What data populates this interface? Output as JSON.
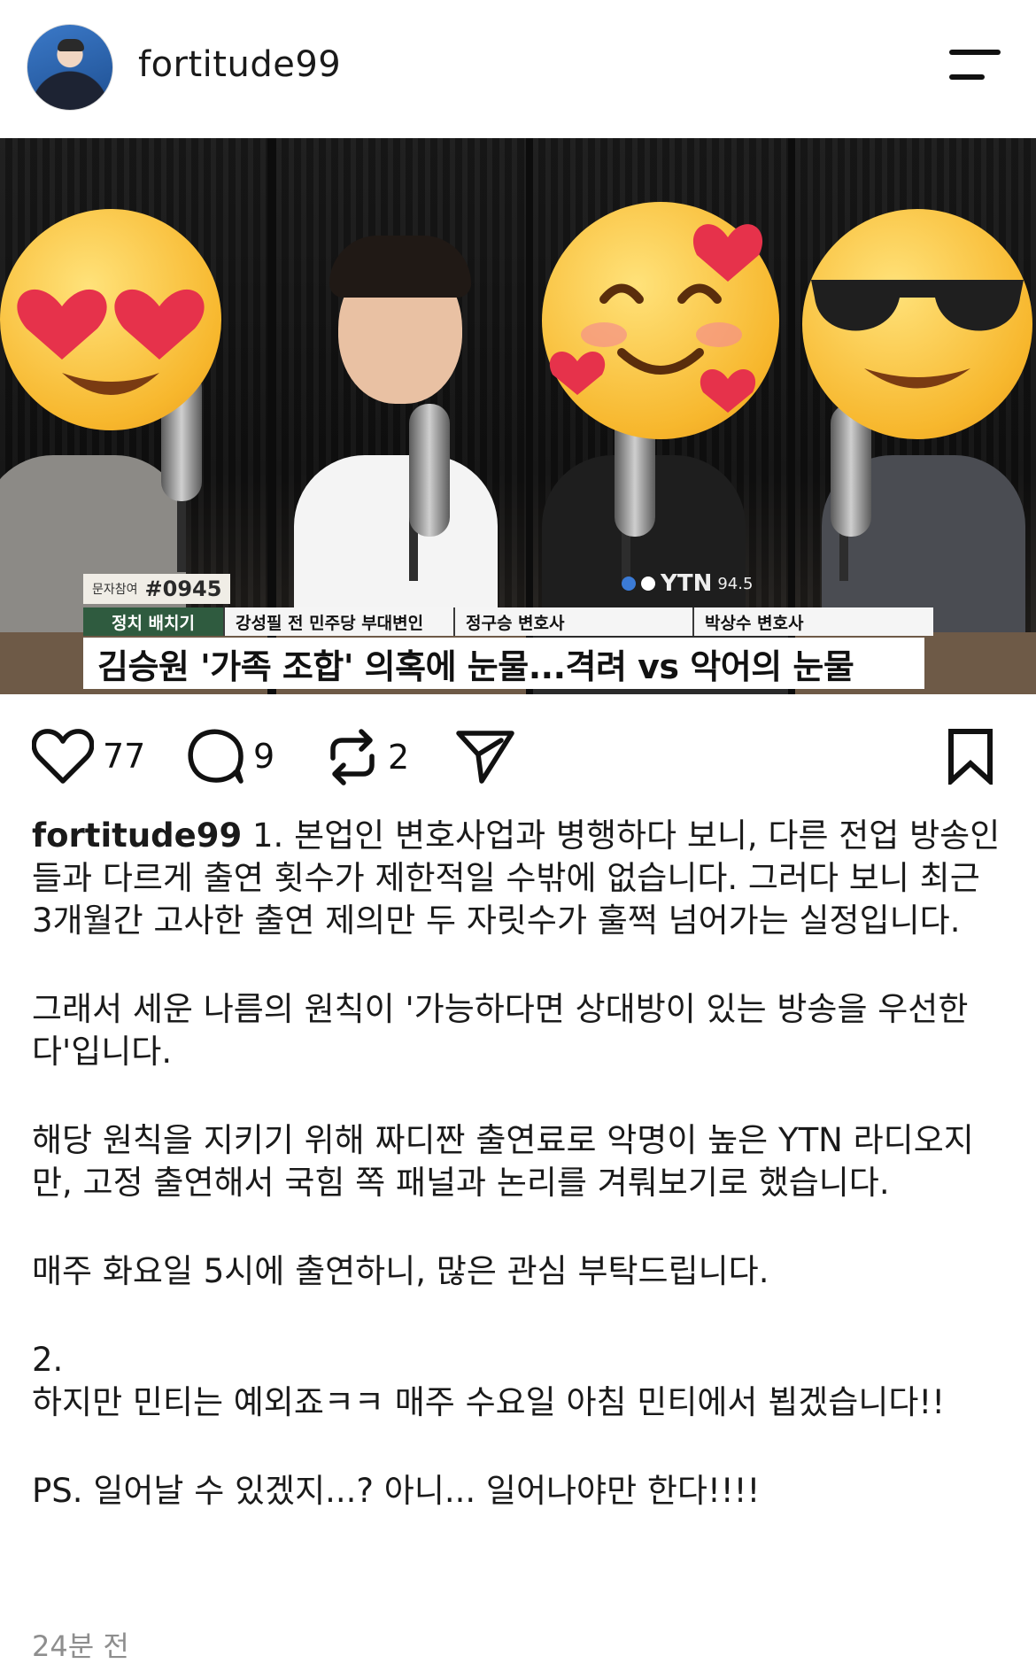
{
  "header": {
    "username": "fortitude99"
  },
  "media": {
    "sms_label": "문자참여",
    "sms_number": "#0945",
    "segment_label": "정치 배치기",
    "guest_1": "강성필 전 민주당 부대변인",
    "guest_2": "정구승 변호사",
    "guest_3": "박상수 변호사",
    "headline": "김승원 '가족 조합' 의혹에 눈물...격려 vs 악어의 눈물",
    "station_logo": "YTN",
    "station_freq": "94.5"
  },
  "actions": {
    "like_count": "77",
    "comment_count": "9",
    "repost_count": "2"
  },
  "caption": {
    "username": "fortitude99",
    "p1": "1. 본업인 변호사업과 병행하다 보니, 다른 전업 방송인들과 다르게 출연 횟수가 제한적일 수밖에 없습니다. 그러다 보니 최근 3개월간 고사한 출연 제의만 두 자릿수가 훌쩍 넘어가는 실정입니다.",
    "p2": "그래서 세운 나름의 원칙이 '가능하다면 상대방이 있는 방송을 우선한다'입니다.",
    "p3": "해당 원칙을 지키기 위해 짜디짠 출연료로 악명이 높은 YTN 라디오지만, 고정 출연해서 국힘 쪽 패널과 논리를 겨뤄보기로 했습니다.",
    "p4": "매주 화요일 5시에 출연하니, 많은 관심 부탁드립니다.",
    "p5": "2.",
    "p6": "하지만 민티는 예외죠ㅋㅋ 매주 수요일 아침 민티에서 뵙겠습니다!!",
    "p7": "PS. 일어날 수 있겠지...? 아니... 일어나야만 한다!!!!"
  },
  "timestamp": "24분 전"
}
